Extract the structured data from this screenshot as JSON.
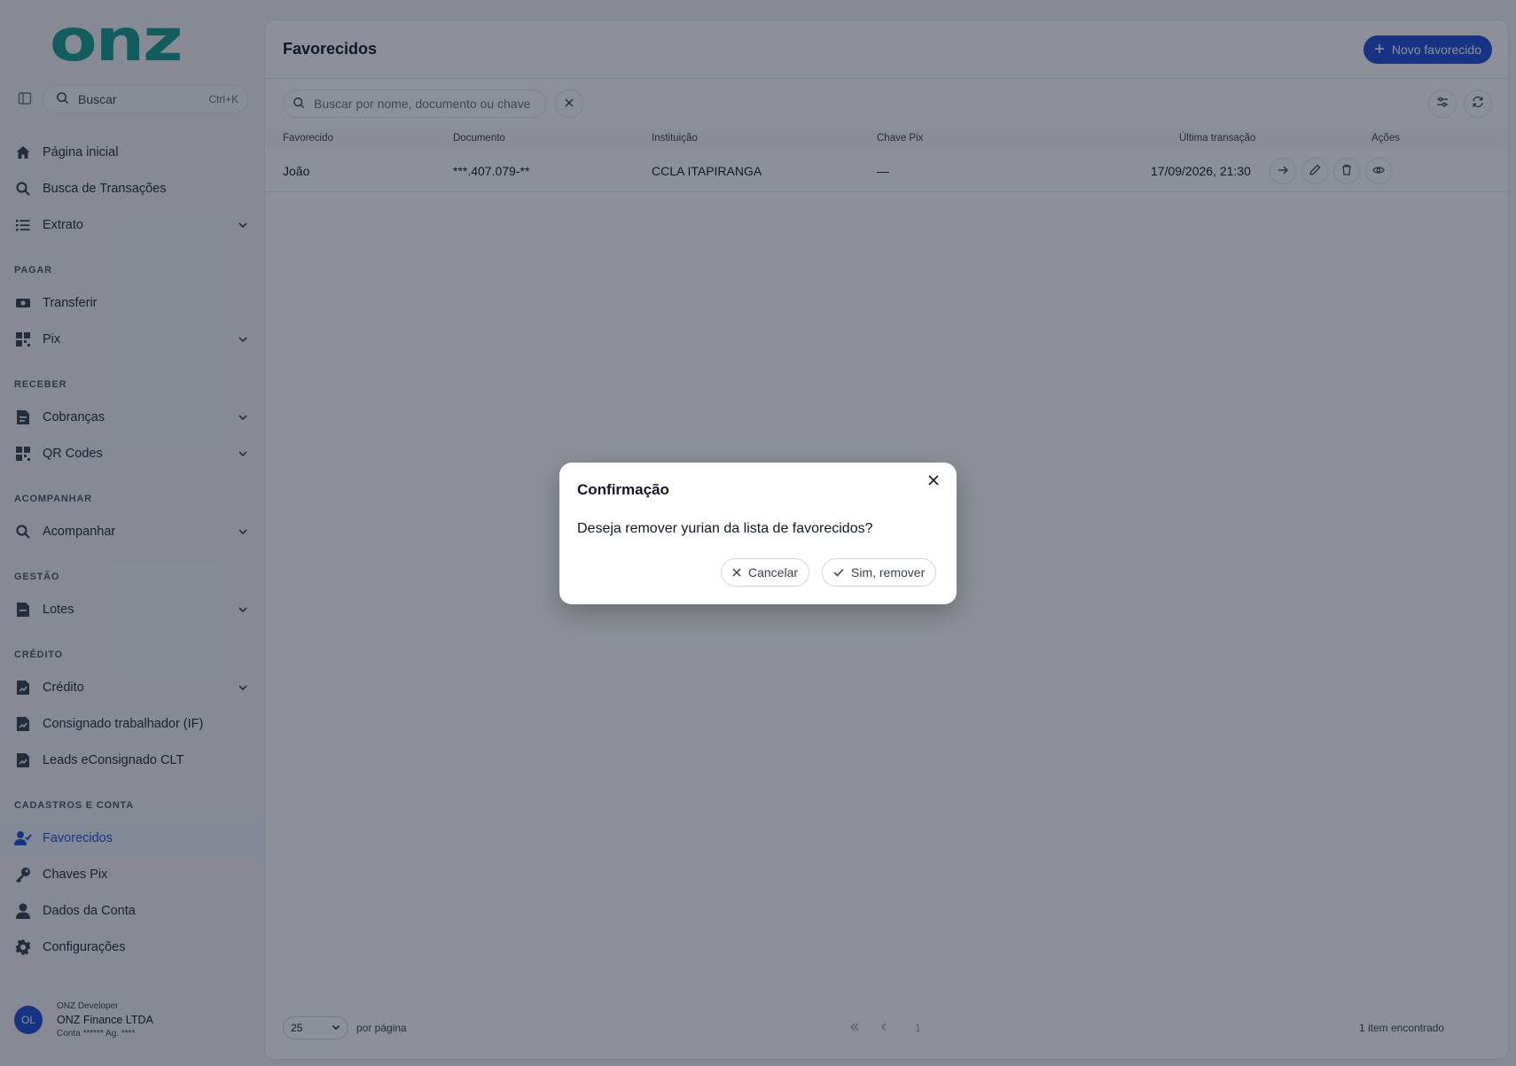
{
  "brand": {
    "logo_text": "onz",
    "accent": "#149e8e",
    "primary": "#1d4ed8"
  },
  "sidebar": {
    "search": {
      "placeholder": "Buscar",
      "shortcut": "Ctrl+K"
    },
    "items": [
      {
        "label": "Página inicial",
        "icon": "home-icon"
      },
      {
        "label": "Busca de Transações",
        "icon": "search-icon"
      },
      {
        "label": "Extrato",
        "icon": "list-icon"
      }
    ],
    "sections": {
      "pagar": {
        "title": "PAGAR",
        "items": [
          {
            "label": "Transferir"
          },
          {
            "label": "Pix"
          }
        ]
      },
      "receber": {
        "title": "RECEBER",
        "items": [
          {
            "label": "Cobranças"
          },
          {
            "label": "QR Codes"
          }
        ]
      },
      "acompanhar": {
        "title": "ACOMPANHAR",
        "items": [
          {
            "label": "Acompanhar"
          }
        ]
      },
      "gestao": {
        "title": "GESTÃO",
        "items": [
          {
            "label": "Lotes"
          }
        ]
      },
      "credito": {
        "title": "CRÉDITO",
        "items": [
          {
            "label": "Crédito"
          },
          {
            "label": "Consignado trabalhador (IF)"
          },
          {
            "label": "Leads eConsignado CLT"
          }
        ]
      },
      "cadastros": {
        "title": "CADASTROS E CONTA",
        "items": [
          {
            "label": "Favorecidos",
            "active": true
          },
          {
            "label": "Chaves Pix"
          },
          {
            "label": "Dados da Conta"
          },
          {
            "label": "Configurações"
          }
        ]
      }
    },
    "user": {
      "initials": "OL",
      "role": "ONZ Developer",
      "company": "ONZ Finance LTDA",
      "account": "Conta ****** Ag. ****"
    }
  },
  "main": {
    "title": "Favorecidos",
    "new_button": "Novo favorecido",
    "search_placeholder": "Buscar por nome, documento ou chave",
    "columns": [
      "Favorecido",
      "Documento",
      "Instituição",
      "Chave Pix",
      "Última transação",
      "Ações"
    ],
    "rows": [
      {
        "favorecido": "João",
        "documento": "***.407.079-**",
        "instituicao": "CCLA ITAPIRANGA",
        "chave_pix": "—",
        "ultima_transacao": "17/09/2026, 21:30"
      }
    ],
    "footer": {
      "per_page": "25",
      "per_page_label": "por página",
      "current_page": "1",
      "count_text": "1 item encontrado"
    }
  },
  "modal": {
    "title": "Confirmação",
    "message": "Deseja remover yurian da lista de favorecidos?",
    "cancel_label": "Cancelar",
    "confirm_label": "Sim, remover"
  }
}
